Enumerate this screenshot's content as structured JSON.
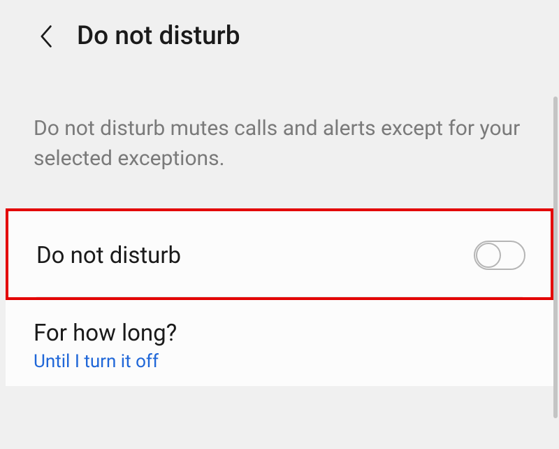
{
  "header": {
    "title": "Do not disturb"
  },
  "description": {
    "text": "Do not disturb mutes calls and alerts except for your selected exceptions."
  },
  "settings": {
    "dnd_toggle": {
      "label": "Do not disturb",
      "enabled": false
    },
    "duration": {
      "label": "For how long?",
      "value": "Until I turn it off"
    }
  }
}
